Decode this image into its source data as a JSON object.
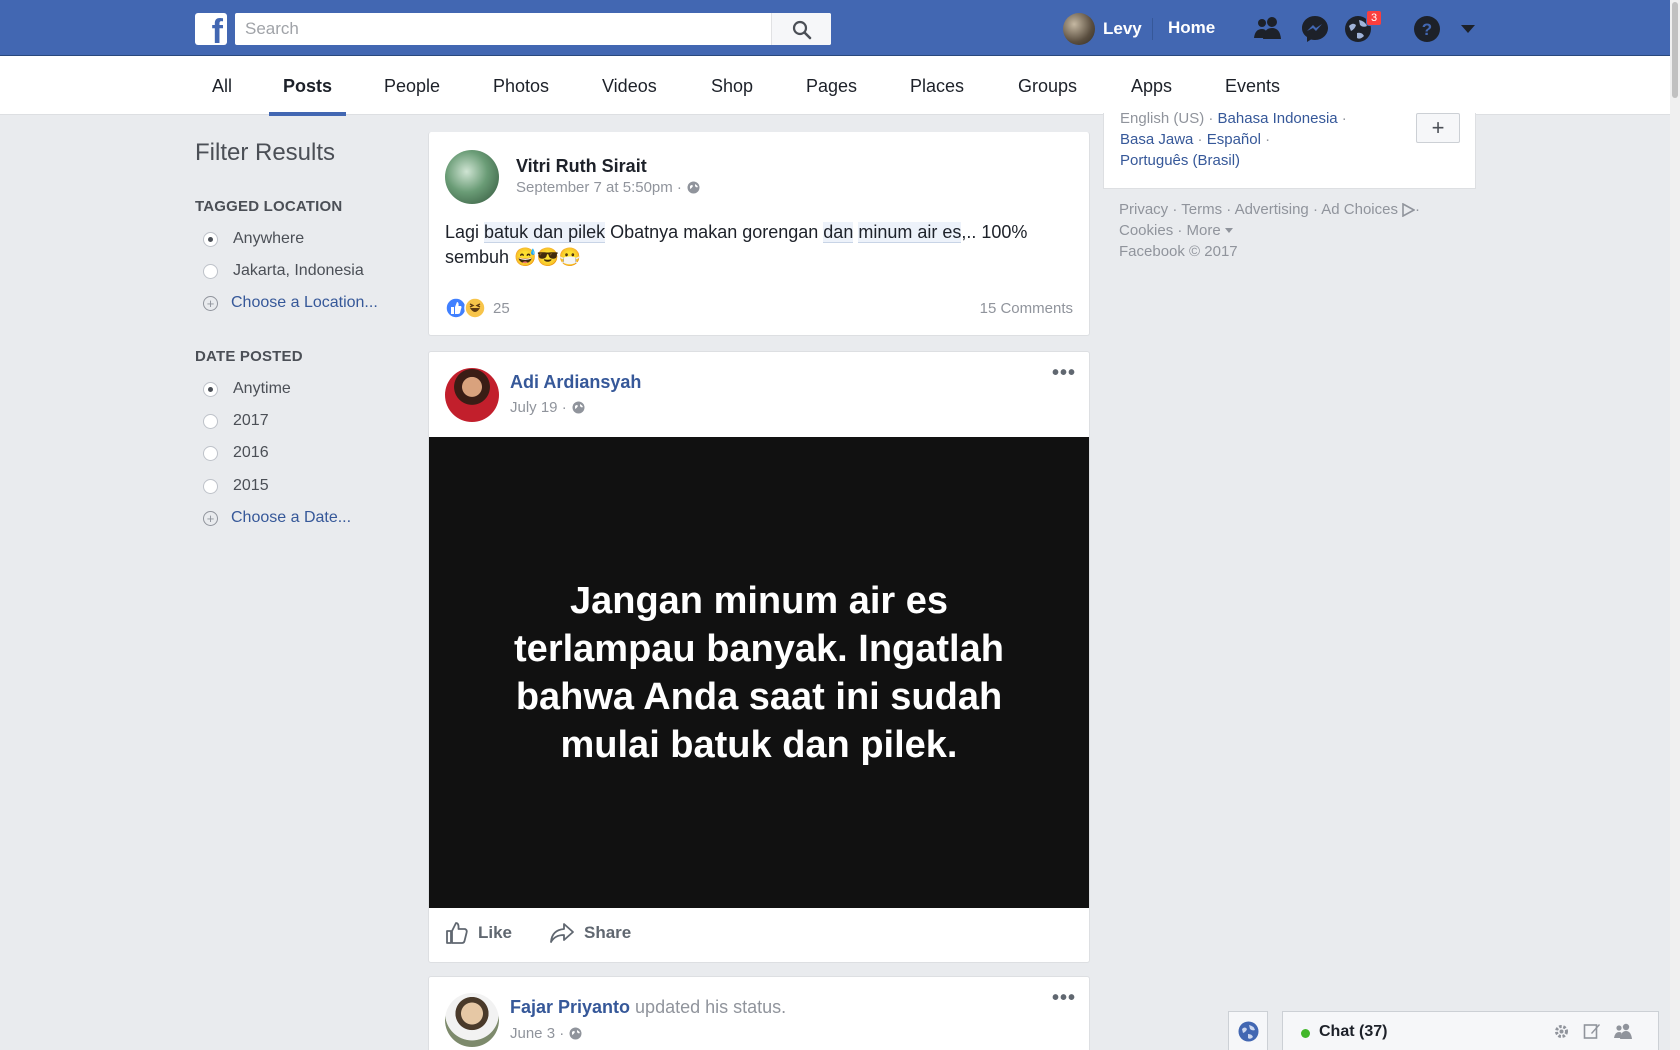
{
  "header": {
    "logo_letter": "f",
    "search_placeholder": "Search",
    "user_name": "Levy",
    "home_label": "Home",
    "notification_count": "3"
  },
  "tabs": [
    {
      "label": "All",
      "active": false
    },
    {
      "label": "Posts",
      "active": true
    },
    {
      "label": "People",
      "active": false
    },
    {
      "label": "Photos",
      "active": false
    },
    {
      "label": "Videos",
      "active": false
    },
    {
      "label": "Shop",
      "active": false
    },
    {
      "label": "Pages",
      "active": false
    },
    {
      "label": "Places",
      "active": false
    },
    {
      "label": "Groups",
      "active": false
    },
    {
      "label": "Apps",
      "active": false
    },
    {
      "label": "Events",
      "active": false
    }
  ],
  "filters": {
    "title": "Filter Results",
    "location": {
      "heading": "TAGGED LOCATION",
      "options": [
        "Anywhere",
        "Jakarta, Indonesia"
      ],
      "selected": "Anywhere",
      "choose_link": "Choose a Location..."
    },
    "date": {
      "heading": "DATE POSTED",
      "options": [
        "Anytime",
        "2017",
        "2016",
        "2015"
      ],
      "selected": "Anytime",
      "choose_link": "Choose a Date..."
    }
  },
  "posts": [
    {
      "author": "Vitri Ruth Sirait",
      "meta": "September 7 at 5:50pm ·",
      "text_parts": {
        "a": "Lagi ",
        "b": "batuk dan pilek",
        "c": " Obatnya makan gorengan ",
        "d": "dan",
        "e": " ",
        "f": "minum air es",
        "g": ",.. 100% sembuh ",
        "emoji": "😅😎😷"
      },
      "reaction_count": "25",
      "comments": "15 Comments"
    },
    {
      "author": "Adi Ardiansyah",
      "meta": "July 19 ·",
      "image_text": "Jangan minum air es terlampau banyak. Ingatlah bahwa Anda saat ini sudah mulai batuk dan pilek.",
      "like_label": "Like",
      "share_label": "Share"
    },
    {
      "author": "Fajar Priyanto",
      "action": " updated his status.",
      "meta": "June 3 ·"
    }
  ],
  "right": {
    "lang_line1_grey": "English (US) · ",
    "lang_line1_link": "Bahasa Indonesia",
    "lang_line1_sep": " ·",
    "lang_line2_a": "Basa Jawa",
    "lang_line2_sep": " · ",
    "lang_line2_b": "Español",
    "lang_line2_end": " ·",
    "lang_line3": "Português (Brasil)",
    "plus": "+",
    "footer_line1": "Privacy · Terms · Advertising · Ad Choices",
    "footer_line1_end": " ·",
    "footer_line2": "Cookies · More",
    "footer_line3": "Facebook © 2017"
  },
  "chat": {
    "label": "Chat (37)"
  },
  "colors": {
    "brand_blue": "#4267b2",
    "link_blue": "#365899",
    "background": "#e9ebee",
    "online_green": "#42b72a",
    "badge_red": "#fa3e3e"
  },
  "icons": [
    "search-icon",
    "friends-icon",
    "messenger-icon",
    "globe-icon",
    "help-icon",
    "caret-down-icon",
    "like-icon",
    "share-icon",
    "gear-icon",
    "compose-icon",
    "group-icon",
    "ad-choices-icon"
  ]
}
